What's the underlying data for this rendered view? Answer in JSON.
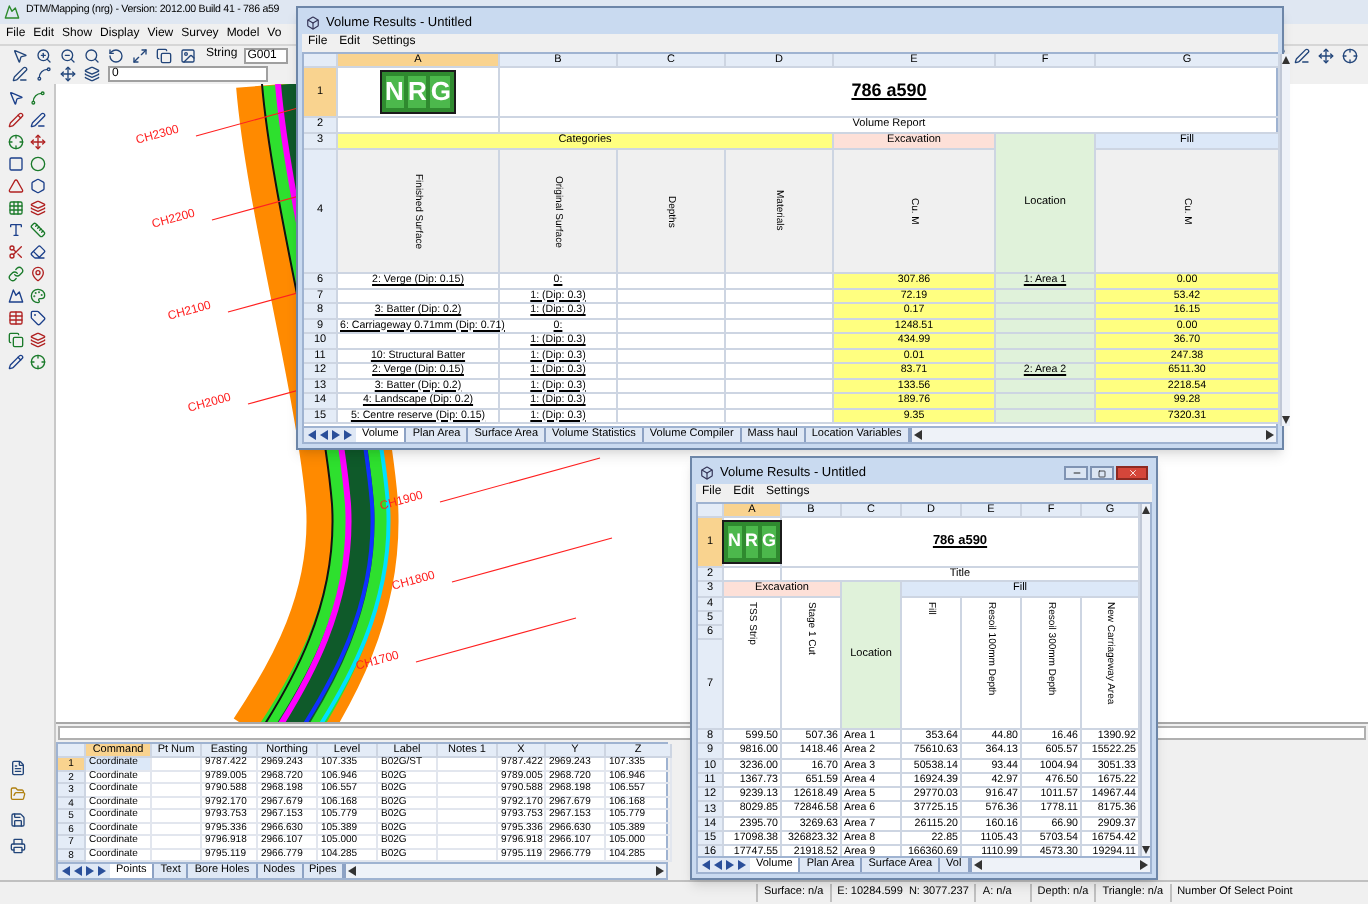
{
  "app": {
    "title": "DTM/Mapping (nrg) - Version: 2012.00 Build 41 - 786 a59",
    "menu": [
      "File",
      "Edit",
      "Show",
      "Display",
      "View",
      "Survey",
      "Model",
      "Vo"
    ],
    "string_label": "String",
    "string_value": "G001",
    "layer_value": "0"
  },
  "canvas": {
    "chainage_labels": [
      "CH2300",
      "CH2200",
      "CH2100",
      "CH2000",
      "CH1900",
      "CH1800",
      "CH1700"
    ]
  },
  "points_table": {
    "columns": [
      {
        "label": "Command",
        "selected": true
      },
      {
        "label": "Pt Num",
        "selected": false
      },
      {
        "label": "Easting",
        "selected": false
      },
      {
        "label": "Northing",
        "selected": false
      },
      {
        "label": "Level",
        "selected": false
      },
      {
        "label": "Label",
        "selected": false
      },
      {
        "label": "Notes 1",
        "selected": false
      },
      {
        "label": "X",
        "selected": false
      },
      {
        "label": "Y",
        "selected": false
      },
      {
        "label": "Z",
        "selected": false
      }
    ],
    "rows": [
      {
        "num": "1",
        "selected": true,
        "cells": [
          "Coordinate",
          null,
          "9787.422",
          "2969.243",
          "107.335",
          "B02G/ST",
          null,
          "9787.422",
          "2969.243",
          "107.335"
        ]
      },
      {
        "num": "2",
        "selected": false,
        "cells": [
          "Coordinate",
          null,
          "9789.005",
          "2968.720",
          "106.946",
          "B02G",
          null,
          "9789.005",
          "2968.720",
          "106.946"
        ]
      },
      {
        "num": "3",
        "selected": false,
        "cells": [
          "Coordinate",
          null,
          "9790.588",
          "2968.198",
          "106.557",
          "B02G",
          null,
          "9790.588",
          "2968.198",
          "106.557"
        ]
      },
      {
        "num": "4",
        "selected": false,
        "cells": [
          "Coordinate",
          null,
          "9792.170",
          "2967.679",
          "106.168",
          "B02G",
          null,
          "9792.170",
          "2967.679",
          "106.168"
        ]
      },
      {
        "num": "5",
        "selected": false,
        "cells": [
          "Coordinate",
          null,
          "9793.753",
          "2967.153",
          "105.779",
          "B02G",
          null,
          "9793.753",
          "2967.153",
          "105.779"
        ]
      },
      {
        "num": "6",
        "selected": false,
        "cells": [
          "Coordinate",
          null,
          "9795.336",
          "2966.630",
          "105.389",
          "B02G",
          null,
          "9795.336",
          "2966.630",
          "105.389"
        ]
      },
      {
        "num": "7",
        "selected": false,
        "cells": [
          "Coordinate",
          null,
          "9796.918",
          "2966.107",
          "105.000",
          "B02G",
          null,
          "9796.918",
          "2966.107",
          "105.000"
        ]
      },
      {
        "num": "8",
        "selected": false,
        "cells": [
          "Coordinate",
          null,
          "9795.119",
          "2966.779",
          "104.285",
          "B02G",
          null,
          "9795.119",
          "2966.779",
          "104.285"
        ]
      }
    ],
    "tabs": [
      {
        "label": "Points",
        "selected": true
      },
      {
        "label": "Text",
        "selected": false
      },
      {
        "label": "Bore Holes",
        "selected": false
      },
      {
        "label": "Nodes",
        "selected": false
      },
      {
        "label": "Pipes",
        "selected": false
      }
    ]
  },
  "status_bar": [
    "Surface: n/a",
    "E: 10284.599  N: 3077.237",
    "A: n/a",
    "Depth: n/a",
    "Triangle: n/a",
    "Number Of Select Point"
  ],
  "volume_window_1": {
    "title": "Volume Results - Untitled",
    "menu": [
      "File",
      "Edit",
      "Settings"
    ],
    "columns": [
      {
        "label": "A",
        "selected": true
      },
      {
        "label": "B",
        "selected": false
      },
      {
        "label": "C",
        "selected": false
      },
      {
        "label": "D",
        "selected": false
      },
      {
        "label": "E",
        "selected": false
      },
      {
        "label": "F",
        "selected": false
      },
      {
        "label": "G",
        "selected": false
      }
    ],
    "banner": {
      "row": "1",
      "selected": true,
      "logo": [
        "N",
        "R",
        "G"
      ],
      "heading": "786 a590"
    },
    "subtitle": {
      "row": "2",
      "text": "Volume Report"
    },
    "groups": {
      "row": "3",
      "items": [
        {
          "label": "Categories",
          "kind": "category"
        },
        {
          "label": "Excavation",
          "kind": "excavation"
        },
        {
          "label": "Location",
          "kind": "location"
        },
        {
          "label": "Fill",
          "kind": "fill"
        }
      ]
    },
    "headers": {
      "rows": [
        "4"
      ],
      "items": [
        "Finished Surface",
        "Original Surface",
        "Depths",
        "Materials",
        "Cu. M",
        "Cu. M"
      ]
    },
    "rows": [
      {
        "num": "6",
        "cells": [
          "2: Verge (Dip: 0.15)",
          "0:",
          null,
          null,
          "307.86",
          "1: Area 1",
          "0.00"
        ]
      },
      {
        "num": "7",
        "cells": [
          null,
          "1: (Dip: 0.3)",
          null,
          null,
          "72.19",
          null,
          "53.42"
        ]
      },
      {
        "num": "8",
        "cells": [
          "3: Batter (Dip: 0.2)",
          "1: (Dip: 0.3)",
          null,
          null,
          "0.17",
          null,
          "16.15"
        ]
      },
      {
        "num": "9",
        "cells": [
          "6: Carriageway 0.71mm (Dip: 0.71)",
          "0:",
          null,
          null,
          "1248.51",
          null,
          "0.00"
        ]
      },
      {
        "num": "10",
        "cells": [
          null,
          "1: (Dip: 0.3)",
          null,
          null,
          "434.99",
          null,
          "36.70"
        ]
      },
      {
        "num": "11",
        "cells": [
          "10: Structural Batter",
          "1: (Dip: 0.3)",
          null,
          null,
          "0.01",
          null,
          "247.38"
        ]
      },
      {
        "num": "12",
        "cells": [
          "2: Verge (Dip: 0.15)",
          "1: (Dip: 0.3)",
          null,
          null,
          "83.71",
          "2: Area 2",
          "6511.30"
        ]
      },
      {
        "num": "13",
        "cells": [
          "3: Batter (Dip: 0.2)",
          "1: (Dip: 0.3)",
          null,
          null,
          "133.56",
          null,
          "2218.54"
        ]
      },
      {
        "num": "14",
        "cells": [
          "4: Landscape (Dip: 0.2)",
          "1: (Dip: 0.3)",
          null,
          null,
          "189.76",
          null,
          "99.28"
        ]
      },
      {
        "num": "15",
        "cells": [
          "5: Centre reserve (Dip: 0.15)",
          "1: (Dip: 0.3)",
          null,
          null,
          "9.35",
          null,
          "7320.31"
        ]
      }
    ],
    "tabs": [
      {
        "label": "Volume",
        "selected": true
      },
      {
        "label": "Plan Area",
        "selected": false
      },
      {
        "label": "Surface Area",
        "selected": false
      },
      {
        "label": "Volume Statistics",
        "selected": false
      },
      {
        "label": "Volume Compiler",
        "selected": false
      },
      {
        "label": "Mass haul",
        "selected": false
      },
      {
        "label": "Location Variables",
        "selected": false
      }
    ]
  },
  "volume_window_2": {
    "title": "Volume Results - Untitled",
    "menu": [
      "File",
      "Edit",
      "Settings"
    ],
    "columns": [
      {
        "label": "A",
        "selected": true
      },
      {
        "label": "B",
        "selected": false
      },
      {
        "label": "C",
        "selected": false
      },
      {
        "label": "D",
        "selected": false
      },
      {
        "label": "E",
        "selected": false
      },
      {
        "label": "F",
        "selected": false
      },
      {
        "label": "G",
        "selected": false
      }
    ],
    "banner": {
      "row": "1",
      "selected": true,
      "logo": [
        "N",
        "R",
        "G"
      ],
      "heading": "786 a590"
    },
    "subtitle": {
      "row": "2",
      "text": "Title"
    },
    "groups": {
      "row": "3",
      "items": [
        {
          "label": "Excavation",
          "kind": "excavation"
        },
        {
          "label": "Location",
          "kind": "location"
        },
        {
          "label": "Fill",
          "kind": "fill"
        }
      ]
    },
    "headers": {
      "rows": [
        "4",
        "5",
        "6",
        "7"
      ],
      "items": [
        "TSS Strip",
        "Stage 1 Cut",
        "Fill",
        "Resoil 100mm Depth",
        "Resoil 300mm Depth",
        "New Carriageway Area"
      ]
    },
    "rows": [
      {
        "num": "8",
        "cells": [
          "599.50",
          "507.36",
          "Area 1",
          "353.64",
          "44.80",
          "16.46",
          "1390.92"
        ]
      },
      {
        "num": "9",
        "cells": [
          "9816.00",
          "1418.46",
          "Area 2",
          "75610.63",
          "364.13",
          "605.57",
          "15522.25"
        ]
      },
      {
        "num": "10",
        "cells": [
          "3236.00",
          "16.70",
          "Area 3",
          "50538.14",
          "93.44",
          "1004.94",
          "3051.33"
        ]
      },
      {
        "num": "11",
        "cells": [
          "1367.73",
          "651.59",
          "Area 4",
          "16924.39",
          "42.97",
          "476.50",
          "1675.22"
        ]
      },
      {
        "num": "12",
        "cells": [
          "9239.13",
          "12618.49",
          "Area 5",
          "29770.03",
          "916.47",
          "1011.57",
          "14967.44"
        ]
      },
      {
        "num": "13",
        "cells": [
          "8029.85",
          "72846.58",
          "Area 6",
          "37725.15",
          "576.36",
          "1778.11",
          "8175.36"
        ]
      },
      {
        "num": "14",
        "cells": [
          "2395.70",
          "3269.63",
          "Area 7",
          "26115.20",
          "160.16",
          "66.90",
          "2909.37"
        ]
      },
      {
        "num": "15",
        "cells": [
          "17098.38",
          "326823.32",
          "Area 8",
          "22.85",
          "1105.43",
          "5703.54",
          "16754.42"
        ]
      },
      {
        "num": "16",
        "cells": [
          "17747.55",
          "21918.52",
          "Area 9",
          "166360.69",
          "1110.99",
          "4573.30",
          "19294.11"
        ]
      }
    ],
    "tabs": [
      {
        "label": "Volume",
        "selected": true
      },
      {
        "label": "Plan Area",
        "selected": false
      },
      {
        "label": "Surface Area",
        "selected": false
      },
      {
        "label": "Vol",
        "selected": false
      }
    ]
  }
}
